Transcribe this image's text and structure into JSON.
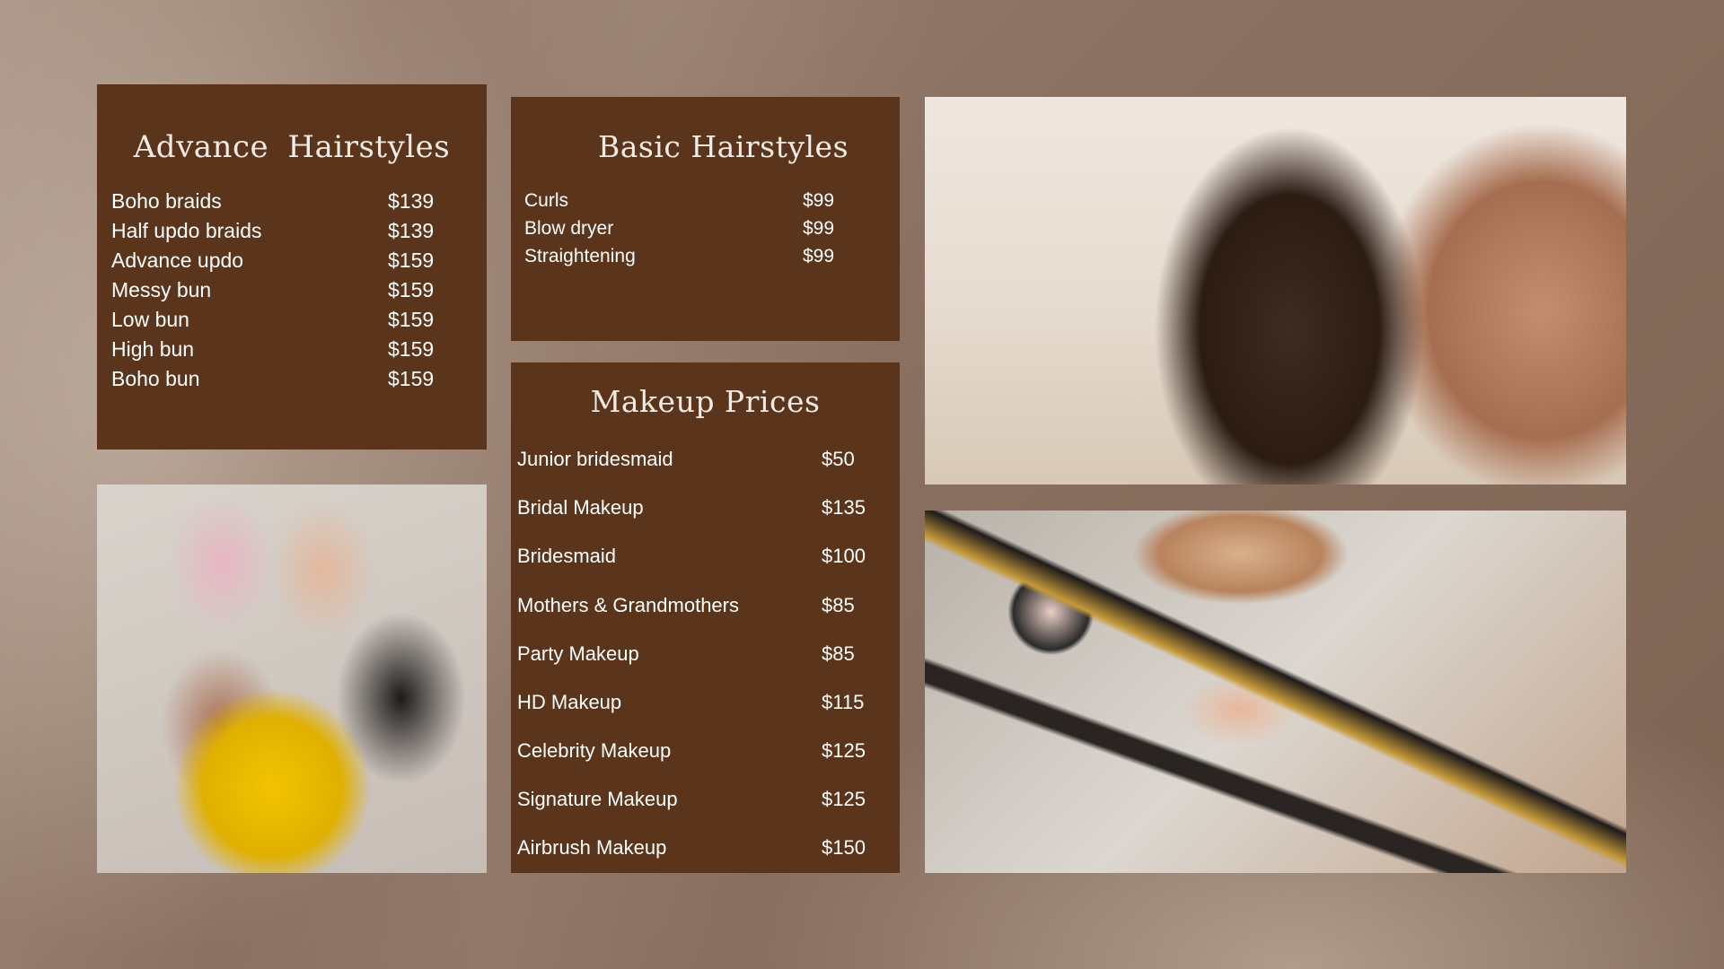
{
  "advance": {
    "title": "Advance  Hairstyles",
    "items": [
      {
        "name": "Boho braids",
        "price": "$139"
      },
      {
        "name": "Half updo braids",
        "price": "$139"
      },
      {
        "name": "Advance updo",
        "price": "$159"
      },
      {
        "name": "Messy bun",
        "price": "$159"
      },
      {
        "name": "Low bun",
        "price": "$159"
      },
      {
        "name": "High bun",
        "price": "$159"
      },
      {
        "name": "Boho bun",
        "price": "$159"
      }
    ]
  },
  "basic": {
    "title": "Basic Hairstyles",
    "items": [
      {
        "name": "Curls",
        "price": "$99"
      },
      {
        "name": "Blow dryer",
        "price": "$99"
      },
      {
        "name": "Straightening",
        "price": "$99"
      }
    ]
  },
  "makeup": {
    "title": "Makeup Prices",
    "items": [
      {
        "name": "Junior bridesmaid",
        "price": "$50"
      },
      {
        "name": "Bridal Makeup",
        "price": "$135"
      },
      {
        "name": "Bridesmaid",
        "price": "$100"
      },
      {
        "name": "Mothers & Grandmothers",
        "price": "$85"
      },
      {
        "name": "Party Makeup",
        "price": "$85"
      },
      {
        "name": "HD Makeup",
        "price": "$115"
      },
      {
        "name": "Celebrity Makeup",
        "price": "$125"
      },
      {
        "name": "Signature Makeup",
        "price": "$125"
      },
      {
        "name": "Airbrush Makeup",
        "price": "$150"
      }
    ]
  },
  "colors": {
    "panel": "#5a341b",
    "background": "#8a7060",
    "text": "#ffffff"
  }
}
